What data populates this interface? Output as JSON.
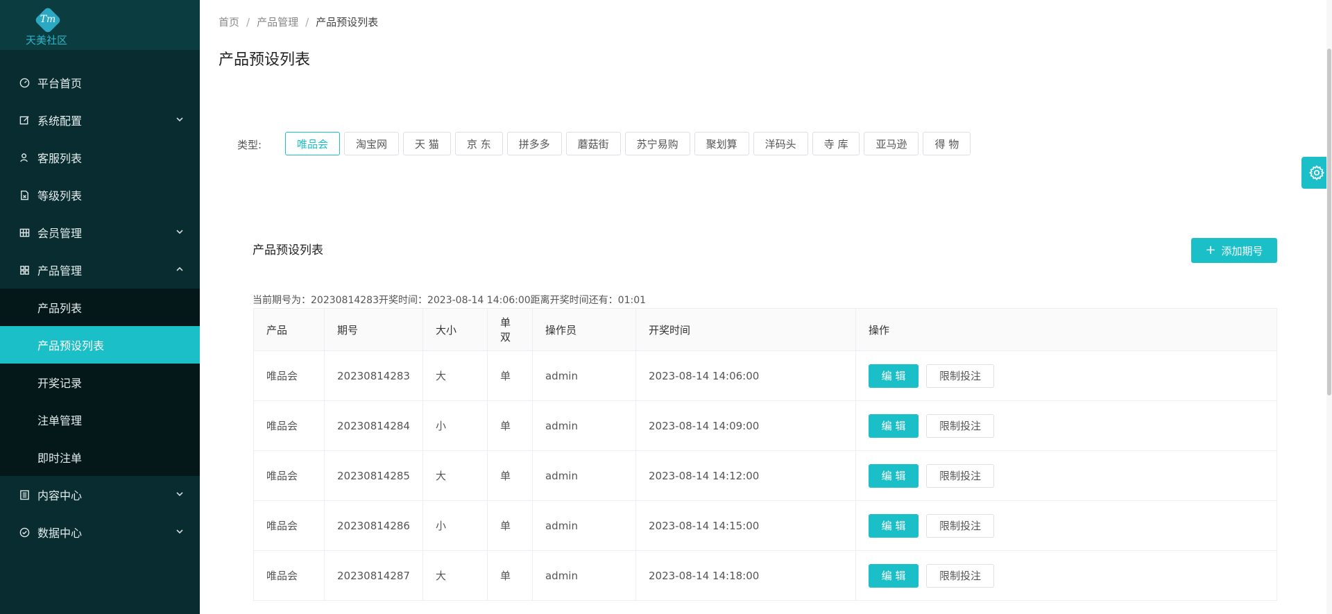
{
  "brand": {
    "mark": "Tm",
    "name": "天美社区",
    "accent": "#1bbfc8"
  },
  "sidebar": {
    "items": [
      {
        "label": "平台首页",
        "icon": "dashboard-icon",
        "arrow": ""
      },
      {
        "label": "系统配置",
        "icon": "edit-icon",
        "arrow": "down"
      },
      {
        "label": "客服列表",
        "icon": "user-icon",
        "arrow": ""
      },
      {
        "label": "等级列表",
        "icon": "document-icon",
        "arrow": ""
      },
      {
        "label": "会员管理",
        "icon": "grid-icon",
        "arrow": "down"
      },
      {
        "label": "产品管理",
        "icon": "apps-icon",
        "arrow": "up"
      }
    ],
    "sub_items": [
      {
        "label": "产品列表",
        "active": false
      },
      {
        "label": "产品预设列表",
        "active": true
      },
      {
        "label": "开奖记录",
        "active": false
      },
      {
        "label": "注单管理",
        "active": false
      },
      {
        "label": "即时注单",
        "active": false
      }
    ],
    "bottom_items": [
      {
        "label": "内容中心",
        "icon": "list-icon",
        "arrow": "down"
      },
      {
        "label": "数据中心",
        "icon": "check-circle-icon",
        "arrow": "down"
      }
    ]
  },
  "breadcrumb": [
    "首页",
    "产品管理",
    "产品预设列表"
  ],
  "page_title": "产品预设列表",
  "filter": {
    "label": "类型:",
    "types": [
      "唯品会",
      "淘宝网",
      "天 猫",
      "京 东",
      "拼多多",
      "蘑菇街",
      "苏宁易购",
      "聚划算",
      "洋码头",
      "寺 库",
      "亚马逊",
      "得 物"
    ],
    "active_index": 0
  },
  "section": {
    "title": "产品预设列表",
    "add_button": "添加期号",
    "period_info": "当前期号为：20230814283开奖时间：2023-08-14 14:06:00距离开奖时间还有：01:01"
  },
  "table": {
    "columns": [
      "产品",
      "期号",
      "大小",
      "单双",
      "操作员",
      "开奖时间",
      "操作"
    ],
    "rows": [
      [
        "唯品会",
        "20230814283",
        "大",
        "单",
        "admin",
        "2023-08-14 14:06:00"
      ],
      [
        "唯品会",
        "20230814284",
        "小",
        "单",
        "admin",
        "2023-08-14 14:09:00"
      ],
      [
        "唯品会",
        "20230814285",
        "大",
        "单",
        "admin",
        "2023-08-14 14:12:00"
      ],
      [
        "唯品会",
        "20230814286",
        "小",
        "单",
        "admin",
        "2023-08-14 14:15:00"
      ],
      [
        "唯品会",
        "20230814287",
        "大",
        "单",
        "admin",
        "2023-08-14 14:18:00"
      ]
    ],
    "edit_label": "编 辑",
    "limit_label": "限制投注"
  },
  "settings_icon": "gear-icon"
}
